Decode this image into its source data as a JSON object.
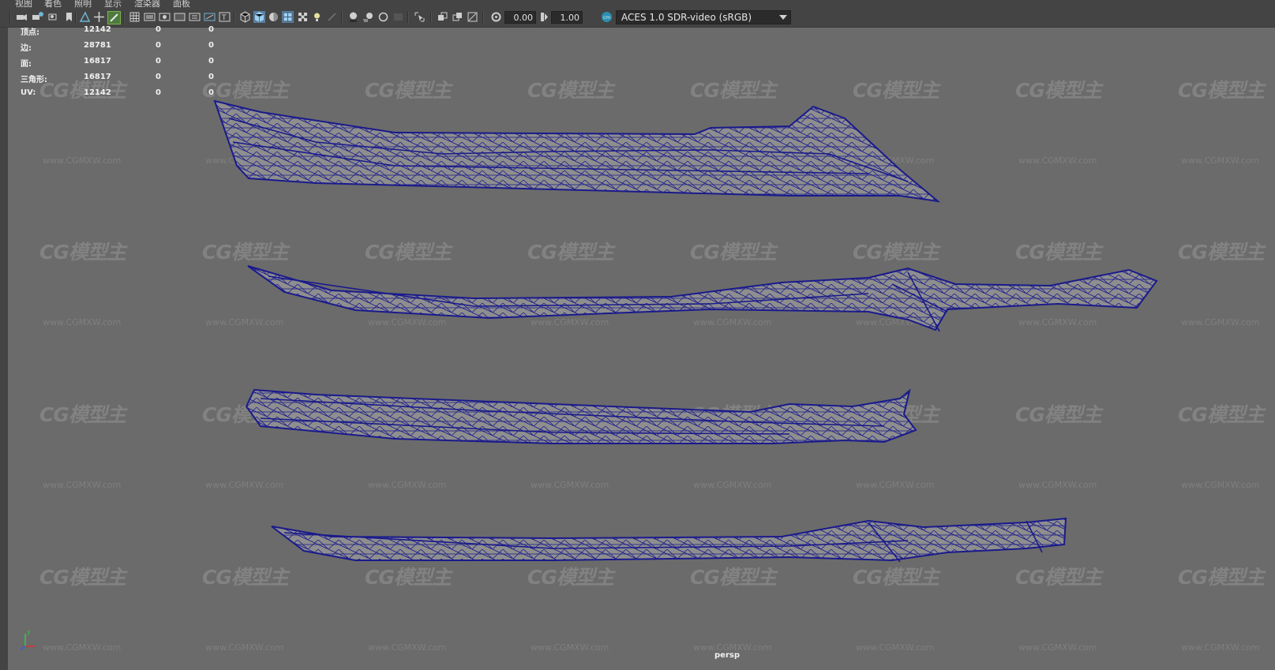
{
  "menu": [
    "视图",
    "着色",
    "照明",
    "显示",
    "渲染器",
    "面板"
  ],
  "toolbar": {
    "exposure": "0.00",
    "gamma": "1.00",
    "color_space": "ACES 1.0 SDR-video (sRGB)"
  },
  "hud": {
    "rows": [
      {
        "label": "顶点:",
        "value": "12142",
        "a": "0",
        "b": "0"
      },
      {
        "label": "边:",
        "value": "28781",
        "a": "0",
        "b": "0"
      },
      {
        "label": "面:",
        "value": "16817",
        "a": "0",
        "b": "0"
      },
      {
        "label": "三角形:",
        "value": "16817",
        "a": "0",
        "b": "0"
      },
      {
        "label": "UV:",
        "value": "12142",
        "a": "0",
        "b": "0"
      }
    ]
  },
  "watermark": {
    "logo": "CG模型主",
    "url": "www.CGMXW.com"
  },
  "camera_label": "persp",
  "axis": {
    "y": "y",
    "x": "x"
  },
  "colors": {
    "viewport_bg": "#6b6b6b",
    "wireframe": "#1a1a8c",
    "mesh_fill": "#8e8e8e",
    "ui_bg": "#444444"
  }
}
